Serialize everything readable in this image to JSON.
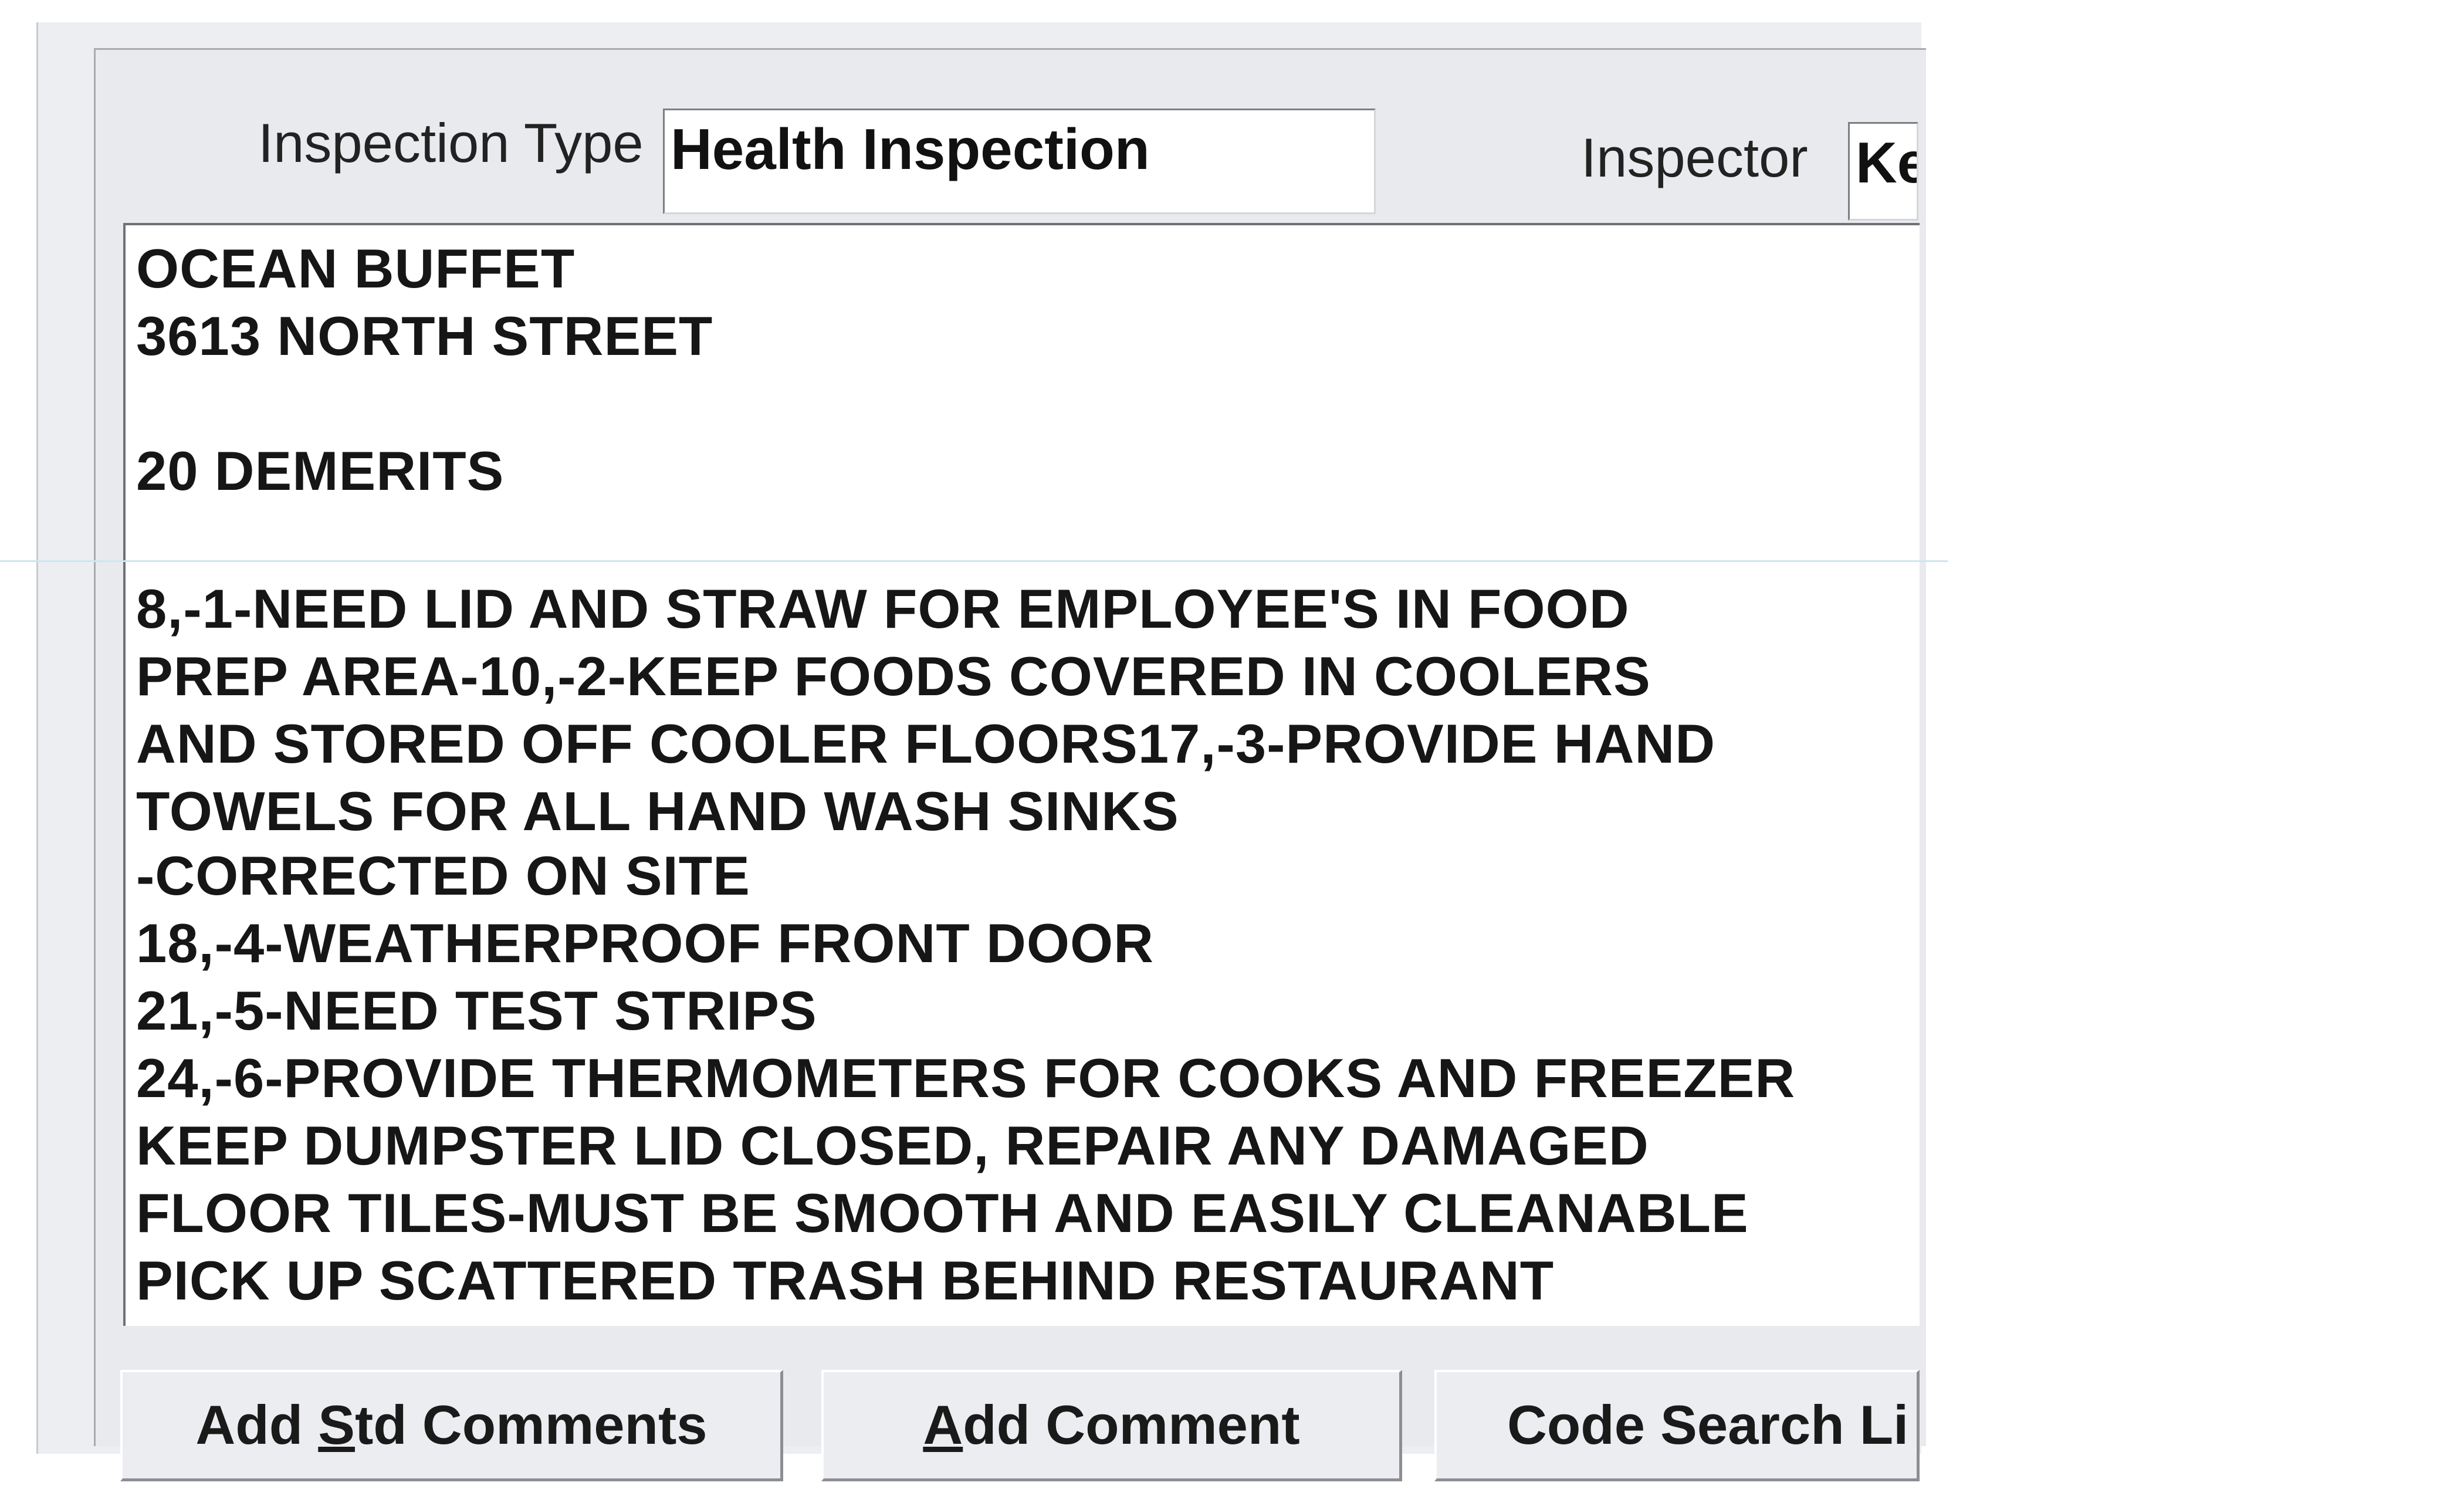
{
  "form": {
    "inspection_type_label": "Inspection Type",
    "inspection_type_value": "Health Inspection",
    "inspector_label": "Inspector",
    "inspector_value": "Ke"
  },
  "comments": {
    "lines": [
      "OCEAN BUFFET",
      "3613 NORTH STREET",
      "",
      "20 DEMERITS",
      "",
      "8,-1-NEED LID AND STRAW FOR EMPLOYEE'S IN FOOD",
      "PREP AREA-10,-2-KEEP FOODS COVERED IN COOLERS",
      "AND STORED OFF COOLER FLOORS17,-3-PROVIDE HAND",
      "TOWELS FOR ALL HAND WASH SINKS",
      "-CORRECTED ON SITE",
      "18,-4-WEATHERPROOF FRONT DOOR",
      "21,-5-NEED TEST STRIPS",
      "24,-6-PROVIDE THERMOMETERS FOR COOKS AND FREEZER",
      "KEEP DUMPSTER LID CLOSED, REPAIR ANY DAMAGED",
      "FLOOR TILES-MUST BE SMOOTH AND EASILY CLEANABLE",
      "PICK UP SCATTERED TRASH BEHIND RESTAURANT"
    ]
  },
  "buttons": {
    "add_std_comments": {
      "pre": "Add ",
      "mnemonic": "S",
      "post": "td Comments"
    },
    "add_comment": {
      "pre": "",
      "mnemonic": "A",
      "post": "dd Comment"
    },
    "code_search": {
      "label": "Code Search Li"
    }
  }
}
